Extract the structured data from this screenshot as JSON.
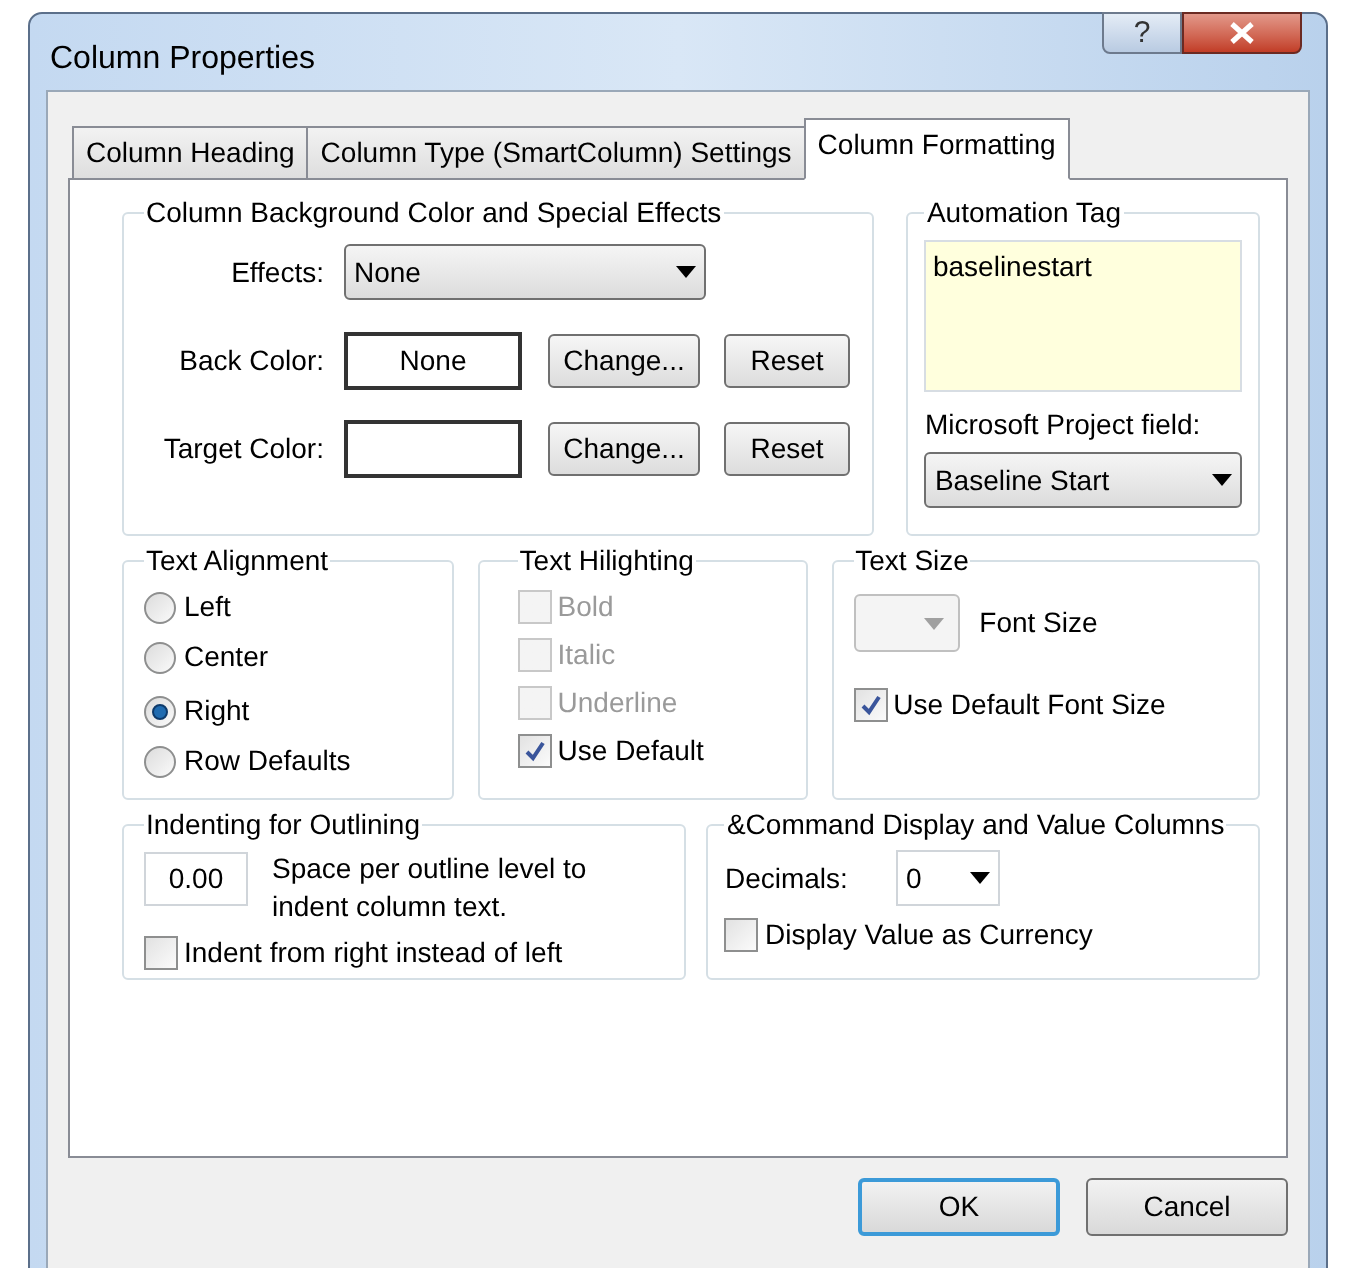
{
  "window": {
    "title": "Column Properties",
    "help_button": "?"
  },
  "tabs": [
    {
      "label": "Column Heading",
      "selected": false
    },
    {
      "label": "Column Type (SmartColumn) Settings",
      "selected": false
    },
    {
      "label": "Column Formatting",
      "selected": true
    }
  ],
  "background_group": {
    "title": "Column Background Color and Special Effects",
    "effects": {
      "label": "Effects:",
      "value": "None"
    },
    "back_color": {
      "label": "Back Color:",
      "value": "None",
      "change": "Change...",
      "reset": "Reset"
    },
    "target_color": {
      "label": "Target Color:",
      "change": "Change...",
      "reset": "Reset"
    }
  },
  "automation_tag": {
    "title": "Automation Tag",
    "value": "baselinestart",
    "field_label": "Microsoft Project field:",
    "field_value": "Baseline Start"
  },
  "text_alignment": {
    "title": "Text Alignment",
    "options": [
      {
        "label": "Left",
        "selected": false
      },
      {
        "label": "Center",
        "selected": false
      },
      {
        "label": "Right",
        "selected": true
      },
      {
        "label": "Row Defaults",
        "selected": false
      }
    ]
  },
  "text_hilighting": {
    "title": "Text Hilighting",
    "options": [
      {
        "label": "Bold",
        "checked": false,
        "disabled": true
      },
      {
        "label": "Italic",
        "checked": false,
        "disabled": true
      },
      {
        "label": "Underline",
        "checked": false,
        "disabled": true
      },
      {
        "label": "Use Default",
        "checked": true,
        "disabled": false
      }
    ]
  },
  "text_size": {
    "title": "Text Size",
    "font_size_label": "Font Size",
    "use_default": {
      "label": "Use Default Font Size",
      "checked": true
    }
  },
  "indenting": {
    "title": "Indenting for Outlining",
    "value": "0.00",
    "description": "Space per outline level to indent column text.",
    "indent_from_right": {
      "label": "Indent from right instead of left",
      "checked": false
    }
  },
  "command_display": {
    "title": "&Command Display and Value Columns",
    "decimals_label": "Decimals:",
    "decimals_value": "0",
    "currency": {
      "label": "Display Value as Currency",
      "checked": false
    }
  },
  "buttons": [
    {
      "label": "OK",
      "default": true
    },
    {
      "label": "Cancel",
      "default": false
    }
  ]
}
